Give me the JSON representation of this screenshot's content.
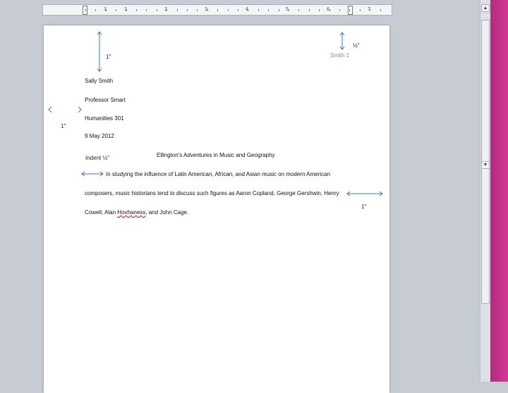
{
  "ruler": {
    "numbers": [
      "1",
      "1",
      "2",
      "3",
      "4",
      "5",
      "6",
      "7"
    ]
  },
  "header": {
    "running_head": "Smith 1"
  },
  "document": {
    "heading": [
      "Sally Smith",
      "Professor Smart",
      "Humanities 301",
      "9 May 2012"
    ],
    "title": "Ellington's Adventures in Music and Geography",
    "body_lines": [
      "In studying the influence of Latin American, African, and Asian music on modern American",
      "composers, music historians tend to discuss such figures as Aaron Copland, George Gershwin, Henry"
    ],
    "last_line_start": "Cowell, Alan ",
    "last_line_misspelled": "Hovhaness",
    "last_line_end": ", and John Cage."
  },
  "annotations": {
    "top_margin": "1\"",
    "header_margin": "½\"",
    "left_margin": "1\"",
    "indent": "Indent ½\"",
    "right_margin": "1\""
  },
  "colors": {
    "arrow": "#3a77b8",
    "accent_stripe": "#c9348c"
  },
  "icons": {
    "scroll_up": "scroll-up-arrow-icon",
    "scroll_down": "scroll-down-arrow-icon"
  }
}
